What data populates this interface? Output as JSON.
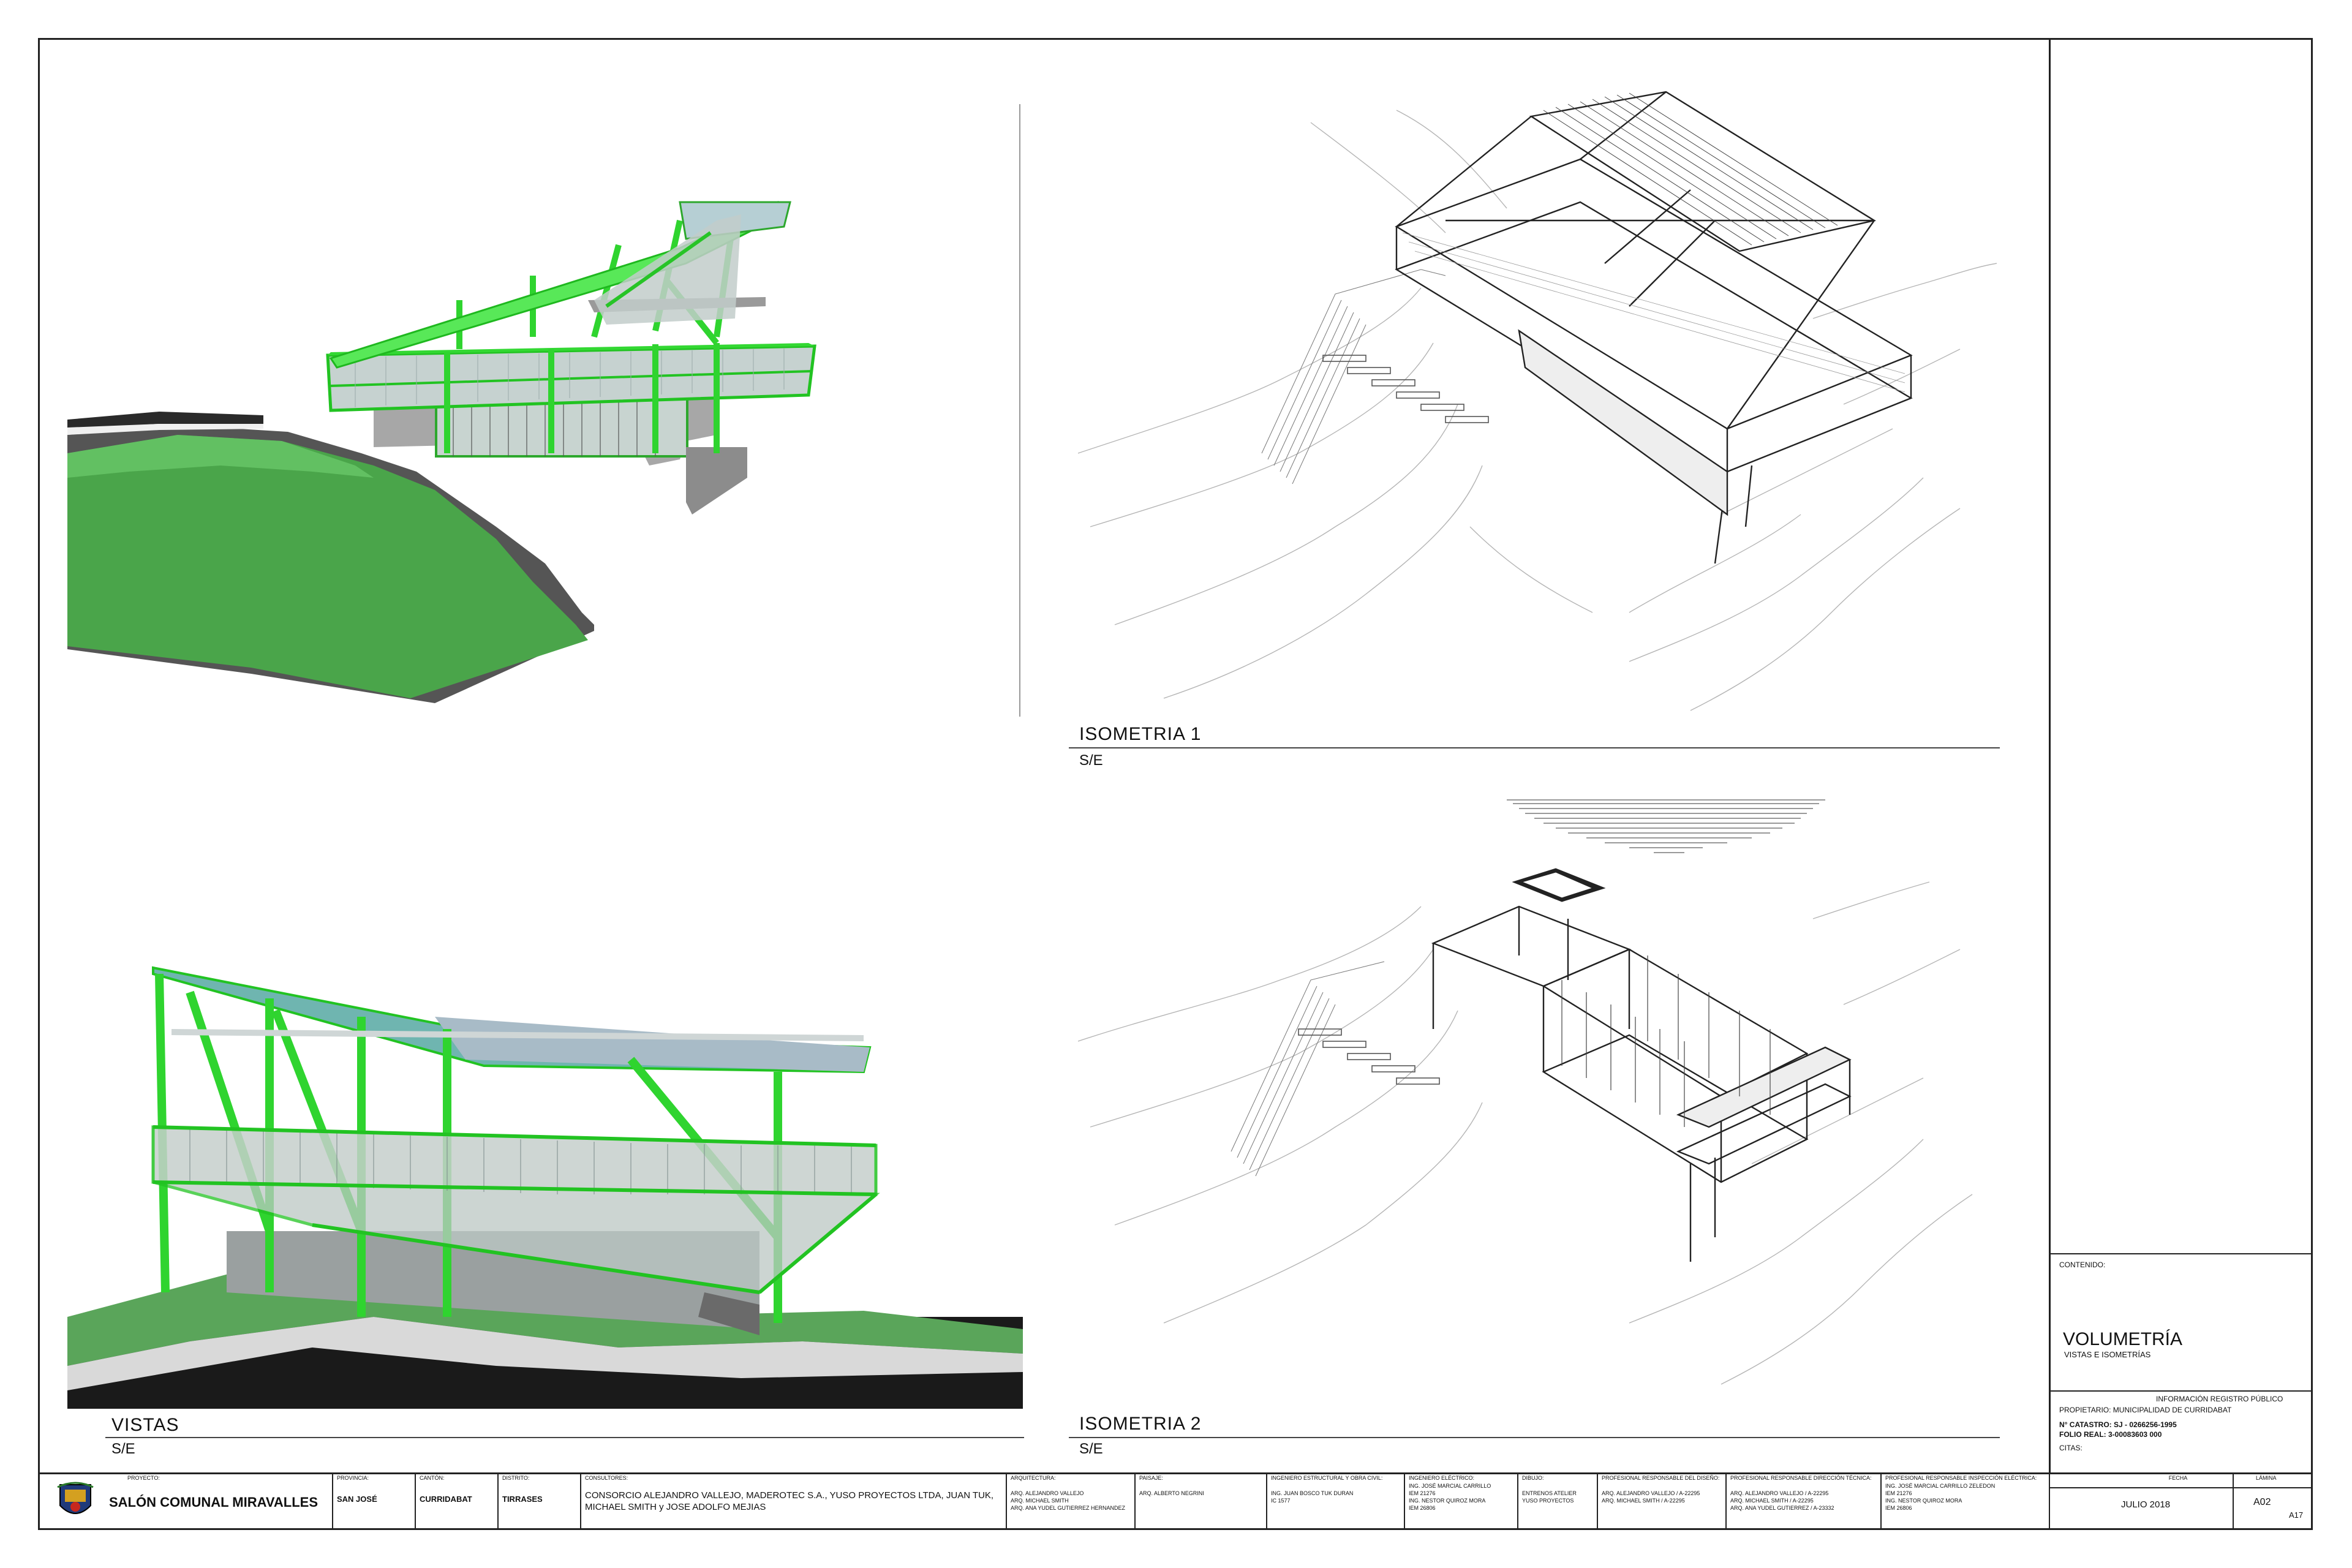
{
  "views": {
    "render_top": {},
    "iso1": {
      "label": "ISOMETRIA 1",
      "scale": "S/E"
    },
    "iso2": {
      "label": "ISOMETRIA 2",
      "scale": "S/E"
    },
    "vistas": {
      "label": "VISTAS",
      "scale": "S/E"
    }
  },
  "side_panel": {
    "contenido_label": "CONTENIDO:",
    "title": "VOLUMETRÍA",
    "subtitle": "VISTAS E ISOMETRÍAS",
    "registro_title": "INFORMACIÓN REGISTRO PÚBLICO",
    "propietario": "PROPIETARIO: MUNICIPALIDAD DE CURRIDABAT",
    "catastro": "N° CATASTRO: SJ - 0266256-1995",
    "folio": "FOLIO REAL: 3-00083603 000",
    "citas": "CITAS:",
    "fecha_label": "FECHA",
    "fecha": "JULIO 2018",
    "lamina_label": "LÁMINA",
    "lamina_a": "A02",
    "lamina_b": "A17"
  },
  "title_block": {
    "proyecto_label": "PROYECTO:",
    "proyecto": "SALÓN COMUNAL MIRAVALLES",
    "provincia_label": "PROVINCIA:",
    "provincia": "SAN JOSÉ",
    "canton_label": "CANTÓN:",
    "canton": "CURRIDABAT",
    "distrito_label": "DISTRITO:",
    "distrito": "TIRRASES",
    "consultores_label": "CONSULTORES:",
    "consultores": "CONSORCIO ALEJANDRO VALLEJO, MADEROTEC S.A., YUSO PROYECTOS LTDA, JUAN TUK,\nMICHAEL SMITH y JOSE ADOLFO MEJIAS",
    "arquitectura_label": "ARQUITECTURA:",
    "arquitectura": "ARQ. ALEJANDRO VALLEJO\nARQ. MICHAEL SMITH\nARQ. ANA YUDEL GUTIERREZ HERNANDEZ",
    "paisaje_label": "PAISAJE:",
    "paisaje": "ARQ. ALBERTO NEGRINI",
    "estructural_label": "INGENIERO ESTRUCTURAL Y OBRA CIVIL:",
    "estructural": "ING. JUAN BOSCO TUK DURAN\nIC 1577",
    "electrico_label": "INGENIERO ELÉCTRICO:",
    "electrico": "ING. JOSÉ MARCIAL CARRILLO\nIEM 21276\nING. NESTOR QUIROZ MORA\nIEM 26806",
    "dibujo_label": "DIBUJO:",
    "dibujo": "ENTRENOS ATELIER\nYUSO PROYECTOS",
    "resp_diseno_label": "PROFESIONAL RESPONSABLE DEL DISEÑO:",
    "resp_diseno": "ARQ. ALEJANDRO VALLEJO / A-22295\nARQ. MICHAEL SMITH / A-22295",
    "resp_direccion_label": "PROFESIONAL RESPONSABLE DIRECCIÓN TÉCNICA:",
    "resp_direccion": "ARQ. ALEJANDRO VALLEJO / A-22295\nARQ. MICHAEL SMITH / A-22295\nARQ. ANA YUDEL GUTIERREZ / A-23332",
    "resp_inspeccion_label": "PROFESIONAL RESPONSABLE INSPECCIÓN ELÉCTRICA:",
    "resp_inspeccion": "ING. JOSÉ MARCIAL CARRILLO ZELEDON\nIEM 21276\nING. NESTOR QUIROZ MORA\nIEM 26806"
  }
}
